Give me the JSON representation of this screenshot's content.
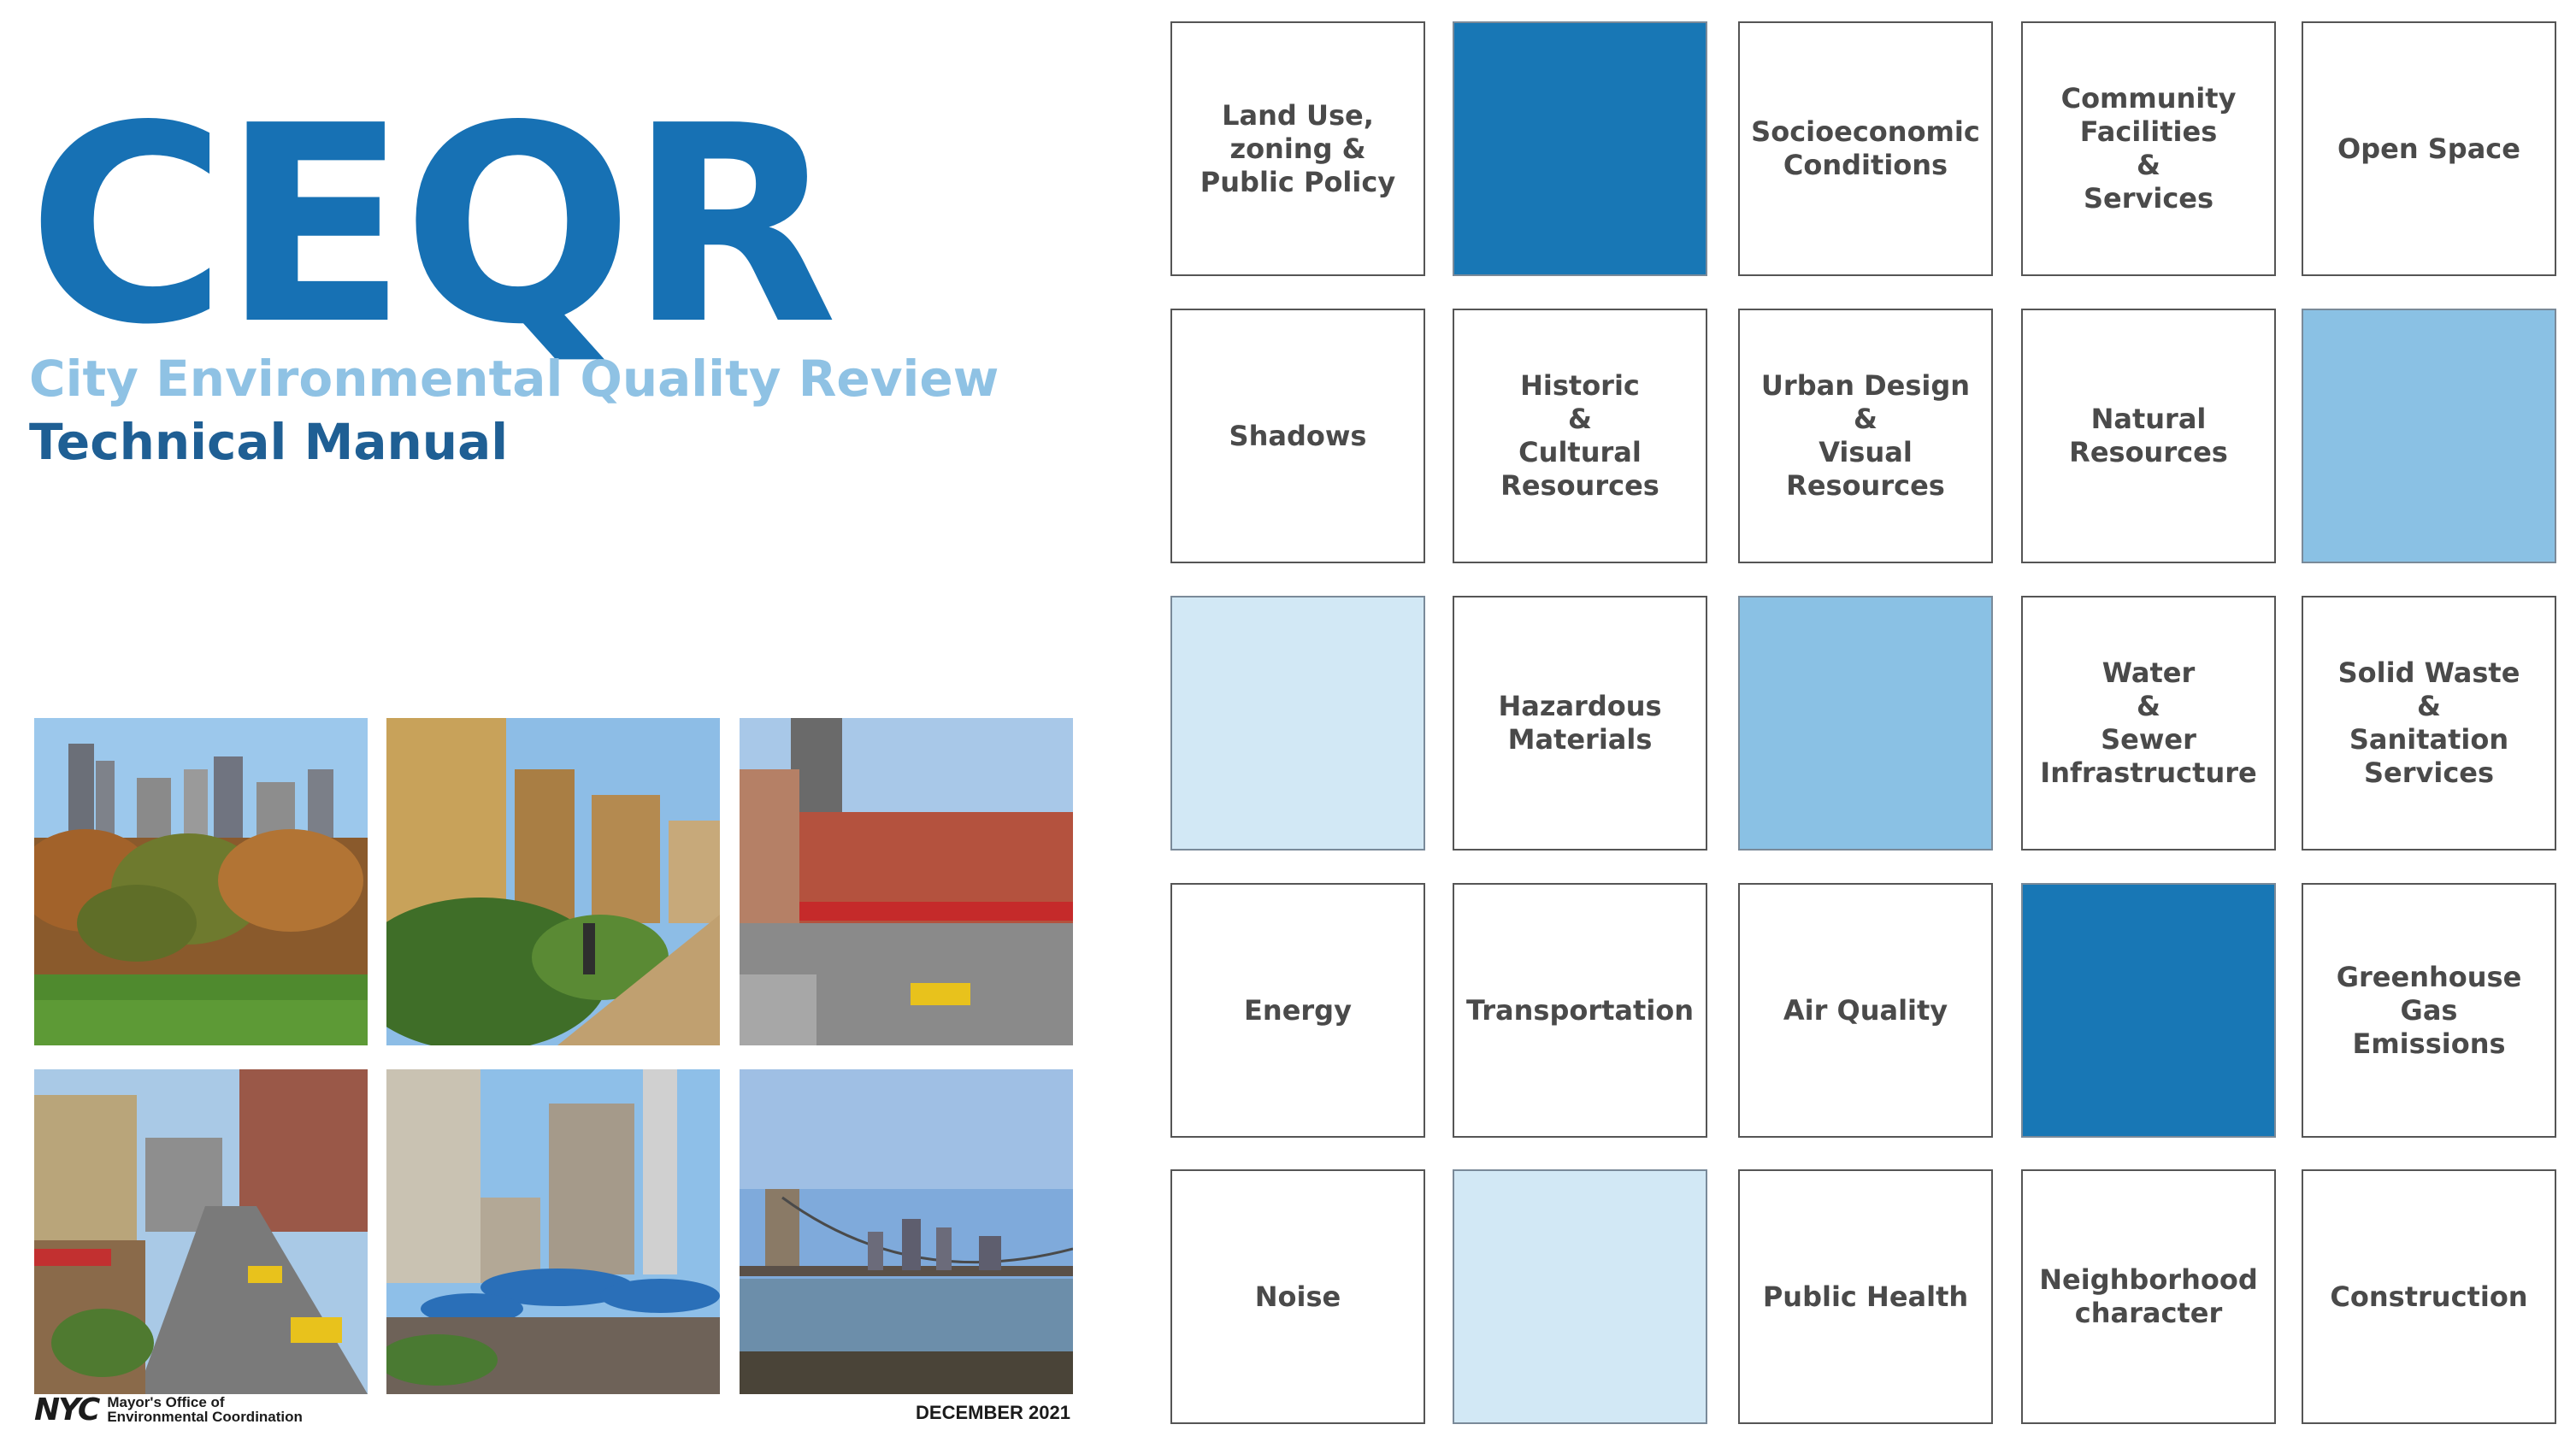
{
  "cover": {
    "title": "CEQR",
    "subtitle": "City Environmental Quality Review",
    "subtitle2": "Technical Manual",
    "title_color": "#1771b4",
    "subtitle_color": "#8fc2e4",
    "subtitle2_color": "#1f5f94",
    "photos": [
      {
        "icon": "park-skyline-photo"
      },
      {
        "icon": "waterfront-path-photo"
      },
      {
        "icon": "street-corner-photo"
      },
      {
        "icon": "avenue-traffic-photo"
      },
      {
        "icon": "plaza-umbrellas-photo"
      },
      {
        "icon": "brooklyn-bridge-photo"
      }
    ],
    "footer": {
      "logo": "NYC",
      "office_line1": "Mayor's Office of",
      "office_line2": "Environmental Coordination",
      "date": "DECEMBER 2021"
    }
  },
  "grid": {
    "colors": {
      "dark": "#1877b5",
      "mid": "#8ac1e4",
      "light": "#d2e8f5"
    },
    "tiles": [
      {
        "label": "Land Use,\nzoning &\nPublic Policy",
        "fill": "white"
      },
      {
        "label": "",
        "fill": "dark"
      },
      {
        "label": "Socioeconomic\nConditions",
        "fill": "white"
      },
      {
        "label": "Community\nFacilities\n&\nServices",
        "fill": "white"
      },
      {
        "label": "Open Space",
        "fill": "white"
      },
      {
        "label": "Shadows",
        "fill": "white"
      },
      {
        "label": "Historic\n&\nCultural\nResources",
        "fill": "white"
      },
      {
        "label": "Urban Design\n&\nVisual\nResources",
        "fill": "white"
      },
      {
        "label": "Natural\nResources",
        "fill": "white"
      },
      {
        "label": "",
        "fill": "mid"
      },
      {
        "label": "",
        "fill": "light"
      },
      {
        "label": "Hazardous\nMaterials",
        "fill": "white"
      },
      {
        "label": "",
        "fill": "mid"
      },
      {
        "label": "Water\n&\nSewer\nInfrastructure",
        "fill": "white"
      },
      {
        "label": "Solid Waste\n&\nSanitation\nServices",
        "fill": "white"
      },
      {
        "label": "Energy",
        "fill": "white"
      },
      {
        "label": "Transportation",
        "fill": "white"
      },
      {
        "label": "Air Quality",
        "fill": "white"
      },
      {
        "label": "",
        "fill": "dark"
      },
      {
        "label": "Greenhouse\nGas\nEmissions",
        "fill": "white"
      },
      {
        "label": "Noise",
        "fill": "white"
      },
      {
        "label": "",
        "fill": "light"
      },
      {
        "label": "Public Health",
        "fill": "white"
      },
      {
        "label": "Neighborhood\ncharacter",
        "fill": "white"
      },
      {
        "label": "Construction",
        "fill": "white"
      }
    ]
  }
}
